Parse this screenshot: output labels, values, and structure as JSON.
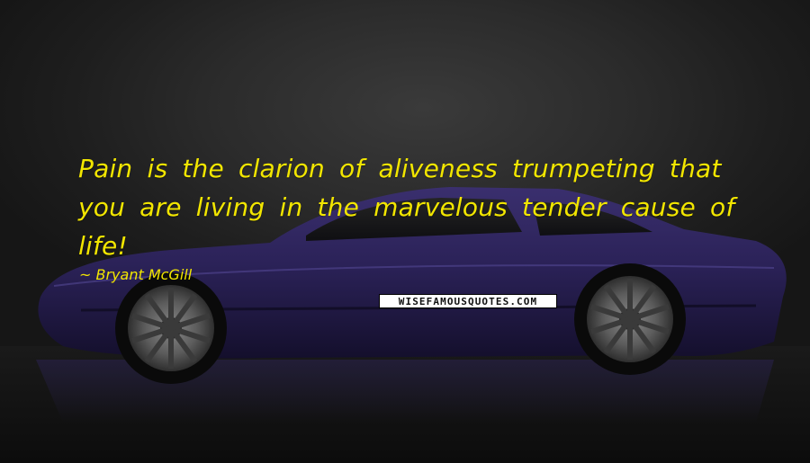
{
  "quote": {
    "text": "Pain is the clarion of aliveness trumpeting that you are living in the marvelous tender cause of life!",
    "author": "Bryant McGill",
    "author_prefix": "~",
    "text_color": "#f2e600"
  },
  "watermark": {
    "text": "WISEFAMOUSQUOTES.COM"
  },
  "background": {
    "subject": "purple muscle car in dark studio",
    "car_color": "#2a2050"
  }
}
